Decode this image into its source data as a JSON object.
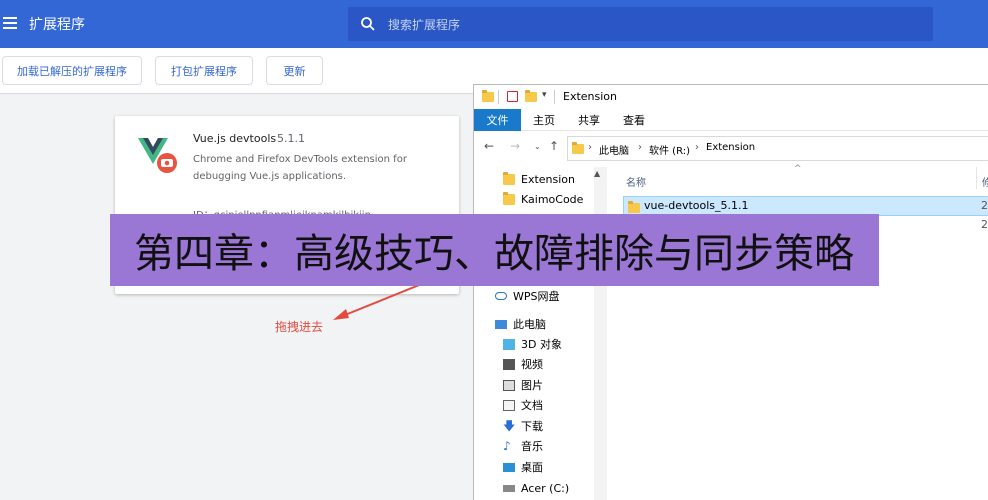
{
  "header": {
    "title": "扩展程序",
    "search_placeholder": "搜索扩展程序"
  },
  "toolbar": {
    "load_unpacked": "加载已解压的扩展程序",
    "pack": "打包扩展程序",
    "update": "更新"
  },
  "extension": {
    "name": "Vue.js devtools",
    "version": "5.1.1",
    "description": "Chrome and Firefox DevTools extension for debugging Vue.js applications.",
    "id_line": "ID：gciniellnnfianmlieiknamkilbikiin"
  },
  "annotation": {
    "drag_hint": "拖拽进去"
  },
  "explorer": {
    "title": "Extension",
    "ribbon_tabs": [
      "文件",
      "主页",
      "共享",
      "查看"
    ],
    "breadcrumbs": [
      "此电脑",
      "软件 (R:)",
      "Extension"
    ],
    "nav_items": [
      "Extension",
      "KaimoCode",
      "WPS网盘",
      "此电脑",
      "3D 对象",
      "视频",
      "图片",
      "文档",
      "下载",
      "音乐",
      "桌面",
      "Acer (C:)"
    ],
    "column_name": "名称",
    "column_modified": "修",
    "selected_file": "vue-devtools_5.1.1",
    "row1_date": "2",
    "row2_date": "2"
  },
  "banner": {
    "text": "第四章：高级技巧、故障排除与同步策略"
  },
  "colors": {
    "chrome_blue": "#3367d6",
    "banner_purple": "#9a76d5",
    "ribbon_active": "#1979ca",
    "selection": "#cce8ff",
    "annotation_red": "#e34b3f"
  }
}
